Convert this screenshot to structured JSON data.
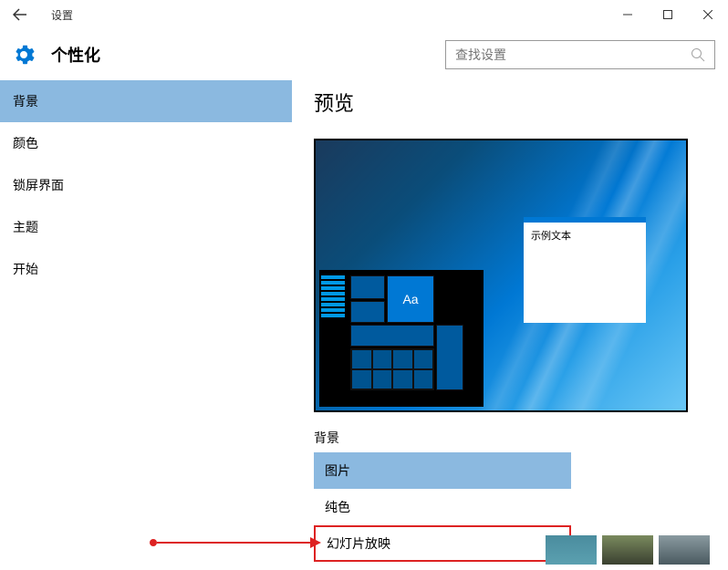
{
  "window": {
    "title": "设置"
  },
  "header": {
    "title": "个性化",
    "search_placeholder": "查找设置"
  },
  "sidebar": {
    "items": [
      {
        "label": "背景",
        "active": true
      },
      {
        "label": "颜色"
      },
      {
        "label": "锁屏界面"
      },
      {
        "label": "主题"
      },
      {
        "label": "开始"
      }
    ]
  },
  "main": {
    "preview_title": "预览",
    "sample_text": "示例文本",
    "aa_label": "Aa",
    "background_label": "背景",
    "dropdown": {
      "options": [
        {
          "label": "图片",
          "selected": true
        },
        {
          "label": "纯色"
        },
        {
          "label": "幻灯片放映",
          "highlighted": true
        }
      ]
    }
  }
}
